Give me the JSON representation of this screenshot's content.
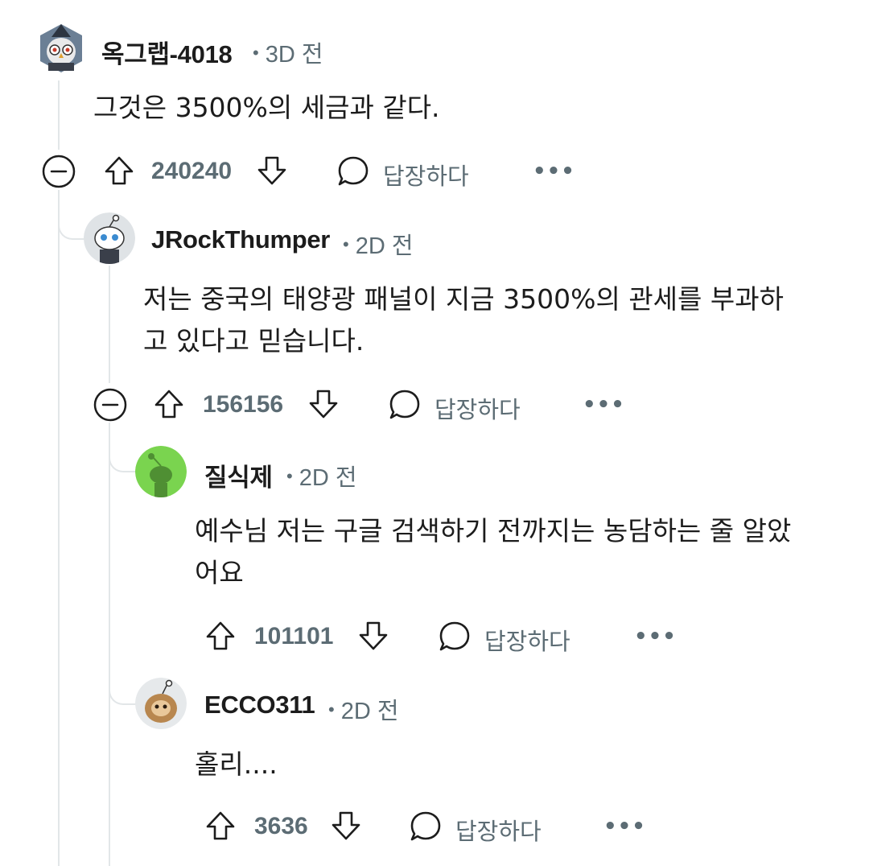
{
  "comments": [
    {
      "username": "옥그랩-4018",
      "time": "3D 전",
      "body": "그것은 3500%의 세금과 같다.",
      "votes": "240240",
      "reply_label": "답장하다",
      "avatar_icon": "wizard-owl-avatar"
    },
    {
      "username": "JRockThumper",
      "time": "2D 전",
      "body_line1": "저는 중국의 태양광 패널이 지금 3500%의 관세를 부과하",
      "body_line2": "고 있다고 믿습니다.",
      "votes": "156156",
      "reply_label": "답장하다",
      "avatar_icon": "snoo-avatar"
    },
    {
      "username": "질식제",
      "time": "2D 전",
      "body_line1": "예수님 저는 구글 검색하기 전까지는 농담하는 줄 알았",
      "body_line2": "어요",
      "votes": "101101",
      "reply_label": "답장하다",
      "avatar_icon": "green-snoo-avatar"
    },
    {
      "username": "ECCO311",
      "time": "2D 전",
      "body": "홀리....",
      "votes": "3636",
      "reply_label": "답장하다",
      "avatar_icon": "brown-snoo-avatar"
    }
  ],
  "icons": {
    "collapse": "collapse-minus-icon",
    "upvote": "upvote-arrow-icon",
    "downvote": "downvote-arrow-icon",
    "reply": "speech-bubble-icon",
    "more": "more-dots-icon"
  },
  "colors": {
    "meta_gray": "#5c6c74",
    "thread_line": "#e2e6e8",
    "text": "#1c1c1c"
  }
}
